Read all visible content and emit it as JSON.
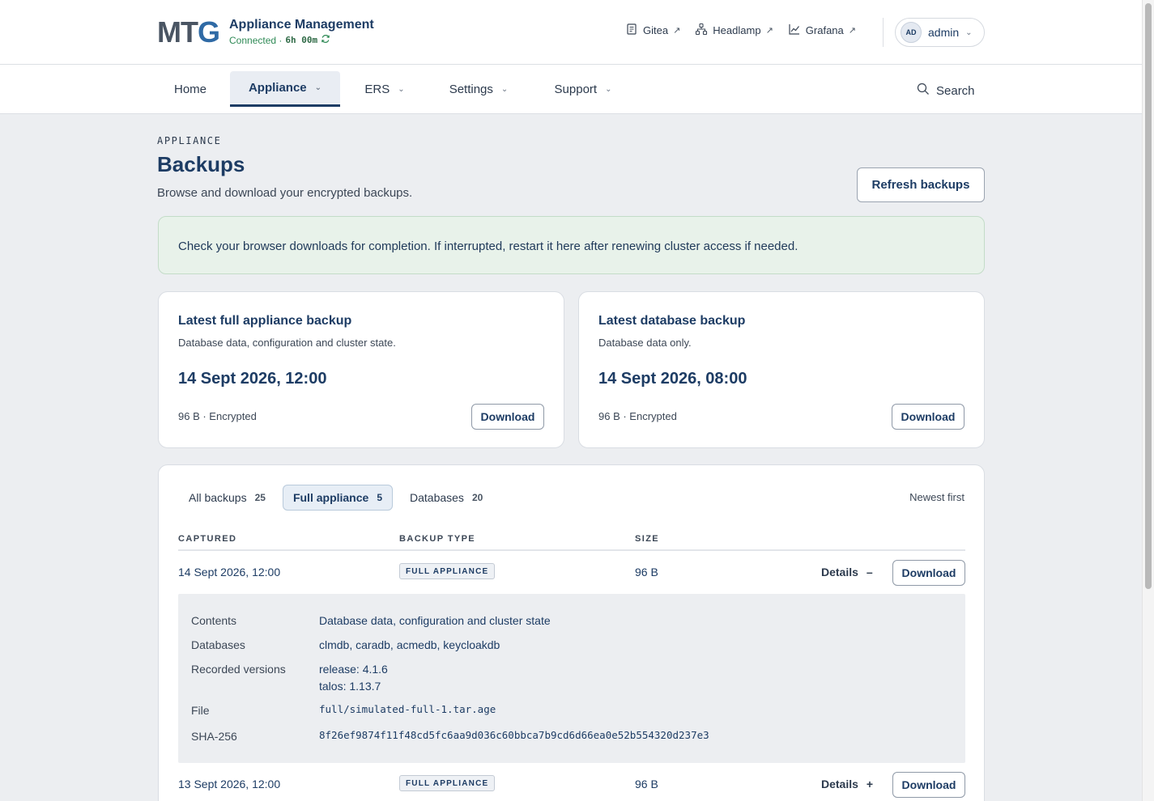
{
  "header": {
    "logo_a": "MT",
    "logo_b": "G",
    "title": "Appliance Management",
    "status_prefix": "Connected ·",
    "status_time": "6h 00m",
    "links": [
      {
        "label": "Gitea",
        "icon": "document-icon"
      },
      {
        "label": "Headlamp",
        "icon": "network-nodes-icon"
      },
      {
        "label": "Grafana",
        "icon": "line-chart-icon"
      }
    ],
    "user_initials": "AD",
    "user_name": "admin"
  },
  "nav": {
    "items": [
      {
        "label": "Home"
      },
      {
        "label": "Appliance"
      },
      {
        "label": "ERS"
      },
      {
        "label": "Settings"
      },
      {
        "label": "Support"
      }
    ],
    "active": "Appliance",
    "search_label": "Search"
  },
  "page": {
    "eyebrow": "APPLIANCE",
    "title": "Backups",
    "subtitle": "Browse and download your encrypted backups.",
    "refresh_label": "Refresh backups",
    "notice": "Check your browser downloads for completion. If interrupted, restart it here after renewing cluster access if needed."
  },
  "cards": [
    {
      "title": "Latest full appliance backup",
      "desc": "Database data, configuration and cluster state.",
      "date": "14 Sept 2026, 12:00",
      "meta": "96 B · Encrypted",
      "button": "Download"
    },
    {
      "title": "Latest database backup",
      "desc": "Database data only.",
      "date": "14 Sept 2026, 08:00",
      "meta": "96 B · Encrypted",
      "button": "Download"
    }
  ],
  "table": {
    "filters": [
      {
        "label": "All backups",
        "count": "25"
      },
      {
        "label": "Full appliance",
        "count": "5"
      },
      {
        "label": "Databases",
        "count": "20"
      }
    ],
    "active_filter": "Full appliance",
    "sort_label": "Newest first",
    "columns": [
      "CAPTURED",
      "BACKUP TYPE",
      "SIZE"
    ],
    "rows": [
      {
        "captured": "14 Sept 2026, 12:00",
        "type": "FULL APPLIANCE",
        "size": "96 B",
        "details_label": "Details",
        "details_sign": "–",
        "button": "Download",
        "expanded": true
      },
      {
        "captured": "13 Sept 2026, 12:00",
        "type": "FULL APPLIANCE",
        "size": "96 B",
        "details_label": "Details",
        "details_sign": "+",
        "button": "Download",
        "expanded": false
      }
    ],
    "details": {
      "contents_label": "Contents",
      "contents": "Database data, configuration and cluster state",
      "databases_label": "Databases",
      "databases": "clmdb, caradb, acmedb, keycloakdb",
      "versions_label": "Recorded versions",
      "release": "release: 4.1.6",
      "talos": "talos: 1.13.7",
      "file_label": "File",
      "file": "full/simulated-full-1.tar.age",
      "sha_label": "SHA-256",
      "sha": "8f26ef9874f11f48cd5fc6aa9d036c60bbca7b9cd6d66ea0e52b554320d237e3"
    }
  }
}
